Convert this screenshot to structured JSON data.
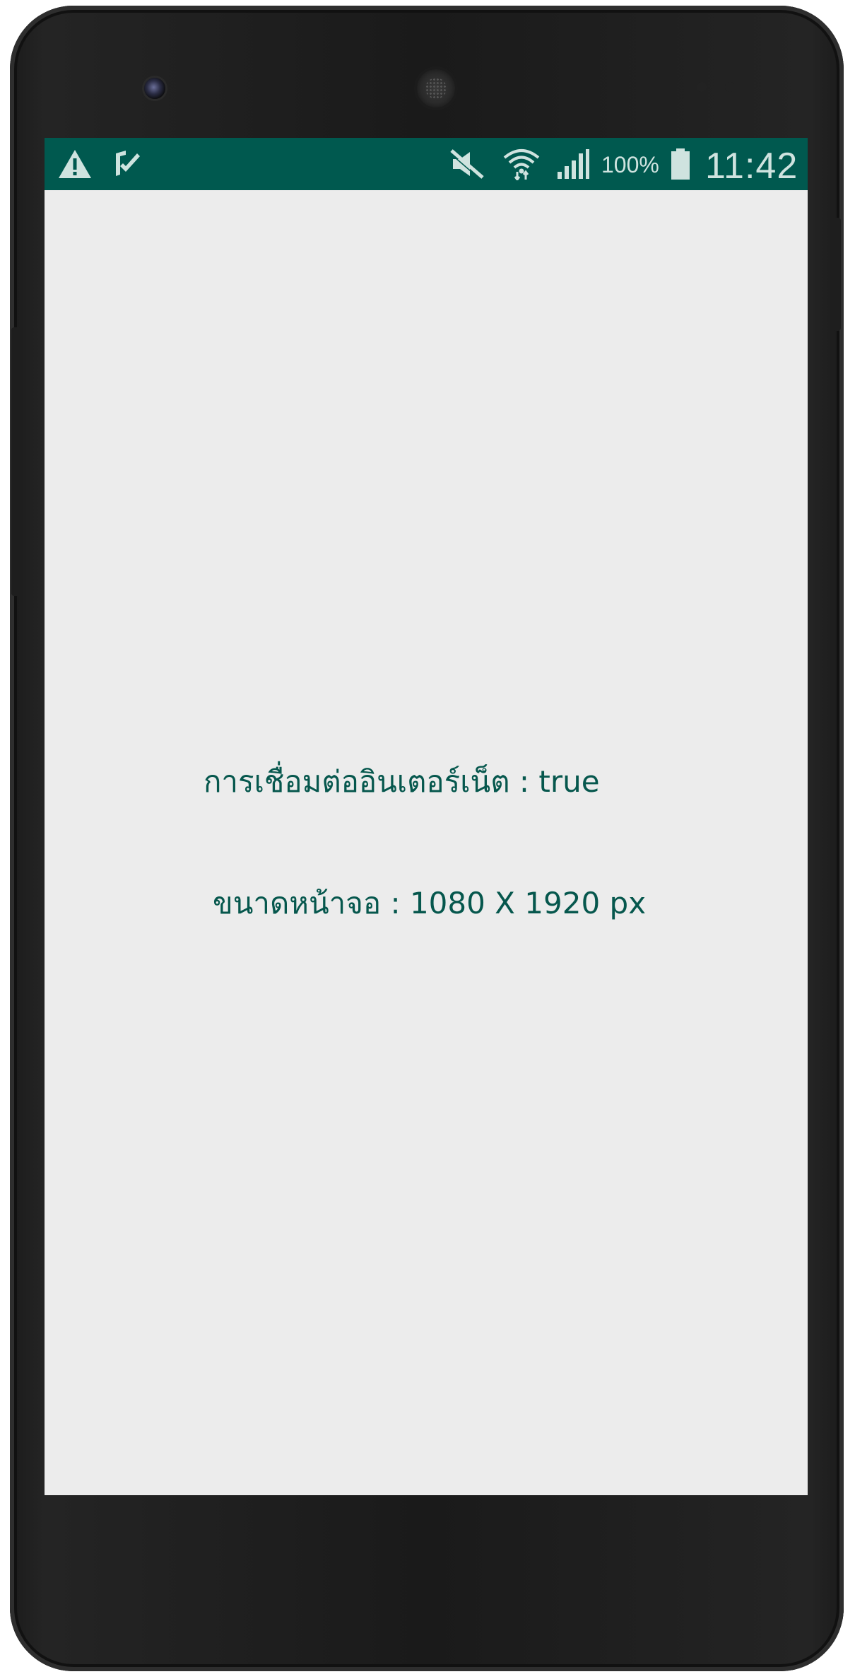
{
  "status_bar": {
    "background_color": "#00594f",
    "left_icons": [
      "warning-icon",
      "task-check-icon"
    ],
    "right_icons": [
      "mute-icon",
      "wifi-icon",
      "cell-signal-icon",
      "battery-icon"
    ],
    "battery_percent": "100%",
    "time": "11:42"
  },
  "main": {
    "internet_connection_text": "การเชื่อมต่ออินเตอร์เน็ต : true",
    "screen_size_text": "ขนาดหน้าจอ : 1080 X 1920 px",
    "text_color": "#06574d",
    "background_color": "#ececec"
  }
}
